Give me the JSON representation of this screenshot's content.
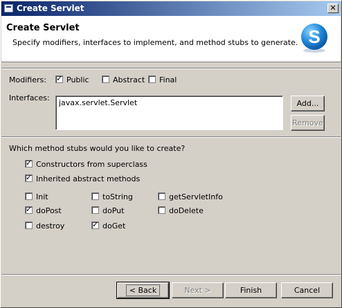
{
  "window": {
    "title": "Create Servlet",
    "close_glyph": "✕"
  },
  "header": {
    "title": "Create Servlet",
    "description": "Specify modifiers, interfaces to implement, and method stubs to generate.",
    "logo_letter": "S",
    "logo_icon": "servlet-s-logo"
  },
  "modifiers": {
    "label": "Modifiers:",
    "public": {
      "label": "Public",
      "checked": true
    },
    "abstract": {
      "label": "Abstract",
      "checked": false
    },
    "final": {
      "label": "Final",
      "checked": false
    }
  },
  "interfaces": {
    "label": "Interfaces:",
    "items": [
      "javax.servlet.Servlet"
    ],
    "add_label": "Add...",
    "remove_label": "Remove"
  },
  "stubs": {
    "question": "Which method stubs would you like to create?",
    "constructors": {
      "label": "Constructors from superclass",
      "checked": true
    },
    "inherited": {
      "label": "Inherited abstract methods",
      "checked": true
    },
    "init": {
      "label": "Init",
      "checked": false
    },
    "tostring": {
      "label": "toString",
      "checked": false
    },
    "getservletinfo": {
      "label": "getServletInfo",
      "checked": false
    },
    "dopost": {
      "label": "doPost",
      "checked": true
    },
    "doput": {
      "label": "doPut",
      "checked": false
    },
    "dodelete": {
      "label": "doDelete",
      "checked": false
    },
    "destroy": {
      "label": "destroy",
      "checked": false
    },
    "doget": {
      "label": "doGet",
      "checked": true
    }
  },
  "buttons": {
    "back": "< Back",
    "next": "Next >",
    "finish": "Finish",
    "cancel": "Cancel"
  },
  "check_glyph": "✓",
  "colors": {
    "title_start": "#0a246a",
    "title_end": "#a6caf0",
    "face": "#d4d0c8",
    "logo": "#1e88d8"
  }
}
